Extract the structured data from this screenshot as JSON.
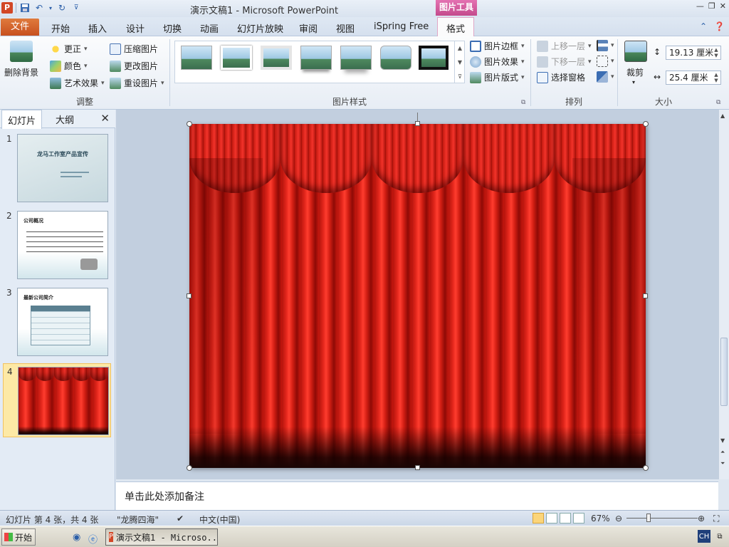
{
  "window": {
    "title": "演示文稿1 - Microsoft PowerPoint",
    "tools_tab": "图片工具",
    "controls": [
      "—",
      "❐",
      "✕"
    ]
  },
  "tabs": {
    "file": "文件",
    "items": [
      "开始",
      "插入",
      "设计",
      "切换",
      "动画",
      "幻灯片放映",
      "审阅",
      "视图",
      "iSpring Free"
    ],
    "active": "格式"
  },
  "ribbon": {
    "adjust": {
      "remove_bg": "删除背景",
      "correct": "更正",
      "color": "颜色",
      "art": "艺术效果",
      "compress": "压缩图片",
      "change": "更改图片",
      "reset": "重设图片",
      "label": "调整"
    },
    "styles": {
      "border": "图片边框",
      "effects": "图片效果",
      "layout": "图片版式",
      "label": "图片样式"
    },
    "arrange": {
      "forward": "上移一层",
      "backward": "下移一层",
      "pane": "选择窗格",
      "label": "排列"
    },
    "size": {
      "crop": "裁剪",
      "height": "19.13 厘米",
      "width": "25.4 厘米",
      "label": "大小"
    }
  },
  "left_panel": {
    "tab_slides": "幻灯片",
    "tab_outline": "大纲",
    "slides": [
      {
        "num": "1",
        "title": "龙马工作室产品宣传"
      },
      {
        "num": "2",
        "title": "公司概况"
      },
      {
        "num": "3",
        "title": "最新公司简介"
      },
      {
        "num": "4",
        "title": ""
      }
    ]
  },
  "notes": {
    "placeholder": "单击此处添加备注"
  },
  "status": {
    "slide_info": "幻灯片 第 4 张，共 4 张",
    "theme": "\"龙腾四海\"",
    "language": "中文(中国)",
    "zoom": "67%",
    "zoom_level": 0.5
  },
  "taskbar": {
    "start": "开始",
    "task": "演示文稿1 - Microso...",
    "ime": "CH"
  },
  "colors": {
    "curtain_red": "#e2261b",
    "accent_file": "#d24726",
    "tools_tab": "#c44a8c"
  }
}
